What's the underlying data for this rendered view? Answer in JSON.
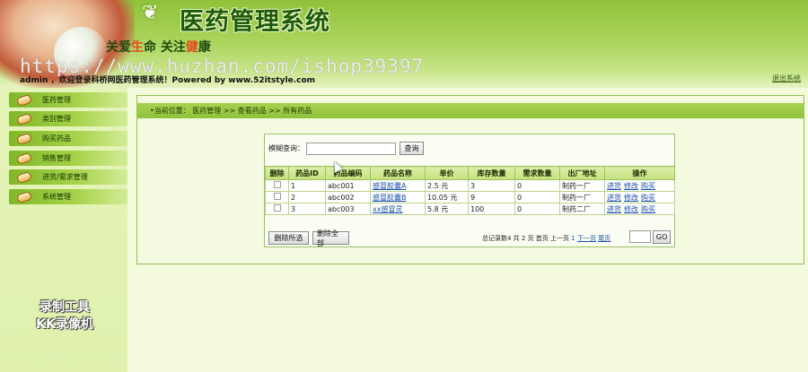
{
  "header": {
    "app_title": "医药管理系统",
    "slogan_prefix": "关爱",
    "slogan_hl1": "生",
    "slogan_mid": "命  关注",
    "slogan_hl2": "健",
    "slogan_suffix": "康",
    "watermark_url": "https://www.huzhan.com/ishop39397",
    "welcome": "admin ，欢迎登录科桥网医药管理系统！Powered by www.52itstyle.com",
    "logout": "退出系统"
  },
  "sidebar": {
    "items": [
      {
        "label": "医药管理"
      },
      {
        "label": "类别管理"
      },
      {
        "label": "购买药品"
      },
      {
        "label": "销售管理"
      },
      {
        "label": "进货/需求管理"
      },
      {
        "label": "系统管理"
      }
    ],
    "watermark_line1": "录制工具",
    "watermark_line2": "KK录像机"
  },
  "breadcrumb": "•当前位置： 医药管理 >> 查看药品 >> 所有药品",
  "search": {
    "label": "模糊查询：",
    "value": "",
    "button": "查询"
  },
  "table": {
    "headers": [
      "删除",
      "药品ID",
      "药品编码",
      "药品名称",
      "单价",
      "库存数量",
      "需求数量",
      "出厂地址",
      "操作"
    ],
    "rows": [
      {
        "id": "1",
        "code": "abc001",
        "name": "感冒胶囊A",
        "price": "2.5 元",
        "stock": "3",
        "demand": "0",
        "factory": "制药一厂"
      },
      {
        "id": "2",
        "code": "abc002",
        "name": "感冒胶囊B",
        "price": "10.05 元",
        "stock": "9",
        "demand": "0",
        "factory": "制药一厂"
      },
      {
        "id": "3",
        "code": "abc003",
        "name": "xx感冒灵",
        "price": "5.8 元",
        "stock": "100",
        "demand": "0",
        "factory": "制药二厂"
      }
    ],
    "actions": [
      "进货",
      "修改",
      "购买"
    ]
  },
  "footer": {
    "delete_selected": "删除所选",
    "delete_all": "删除全部",
    "pager_summary": "总记录数4 共 2 页 首页 上一页 ",
    "current_page": "1",
    "next_page": "下一页",
    "last_page": "尾页",
    "page_value": "",
    "go": "GO"
  }
}
